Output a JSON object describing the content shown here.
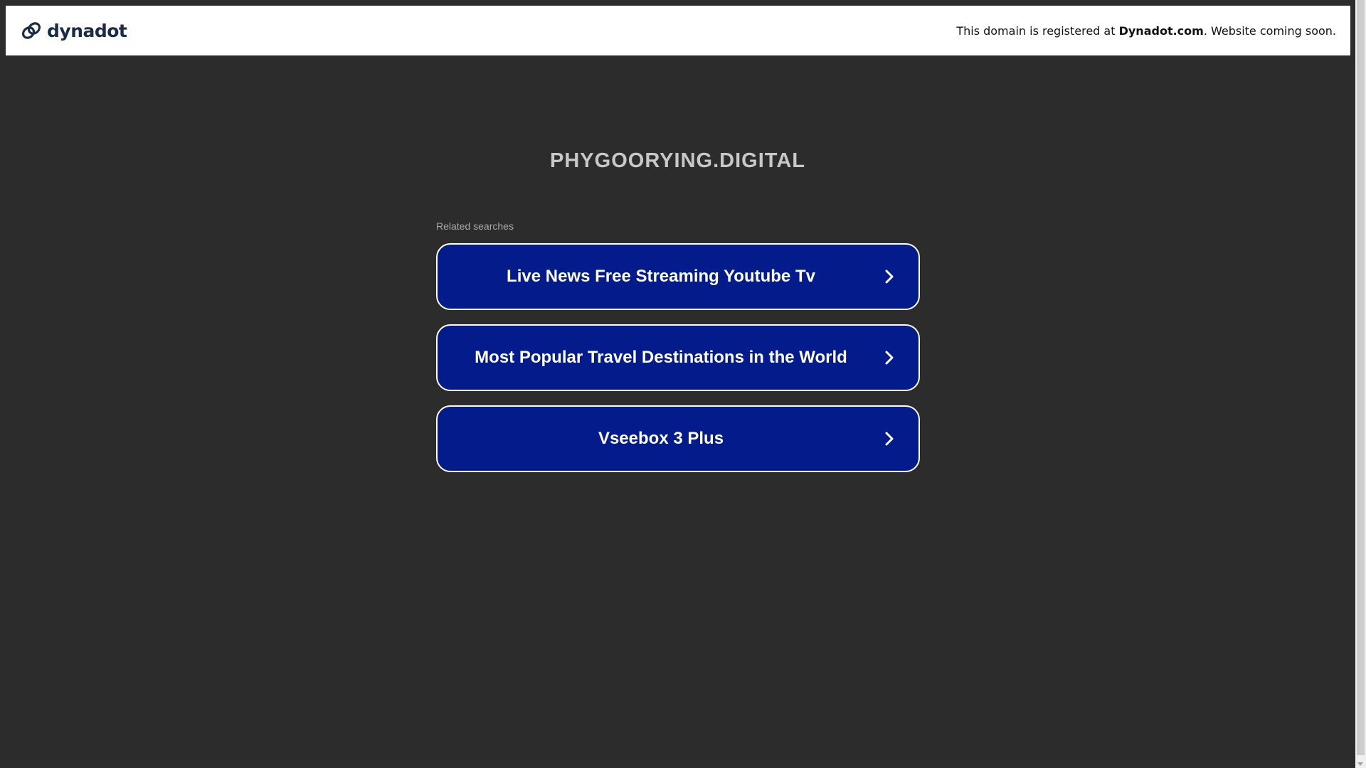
{
  "banner": {
    "brand_name": "dynadot",
    "message_prefix": "This domain is registered at ",
    "message_registrar": "Dynadot.com",
    "message_suffix": ". Website coming soon."
  },
  "main": {
    "domain": "PHYGOORYING.DIGITAL",
    "related_label": "Related searches",
    "searches": [
      {
        "label": "Live News Free Streaming Youtube Tv"
      },
      {
        "label": "Most Popular Travel Destinations in the World"
      },
      {
        "label": "Vseebox 3 Plus"
      }
    ]
  },
  "colors": {
    "background": "#2c2c2c",
    "button_bg": "#041b8c",
    "brand": "#1a2b4b"
  },
  "icons": {
    "brand": "dynadot-logo-icon",
    "chevron": "chevron-right-icon"
  }
}
